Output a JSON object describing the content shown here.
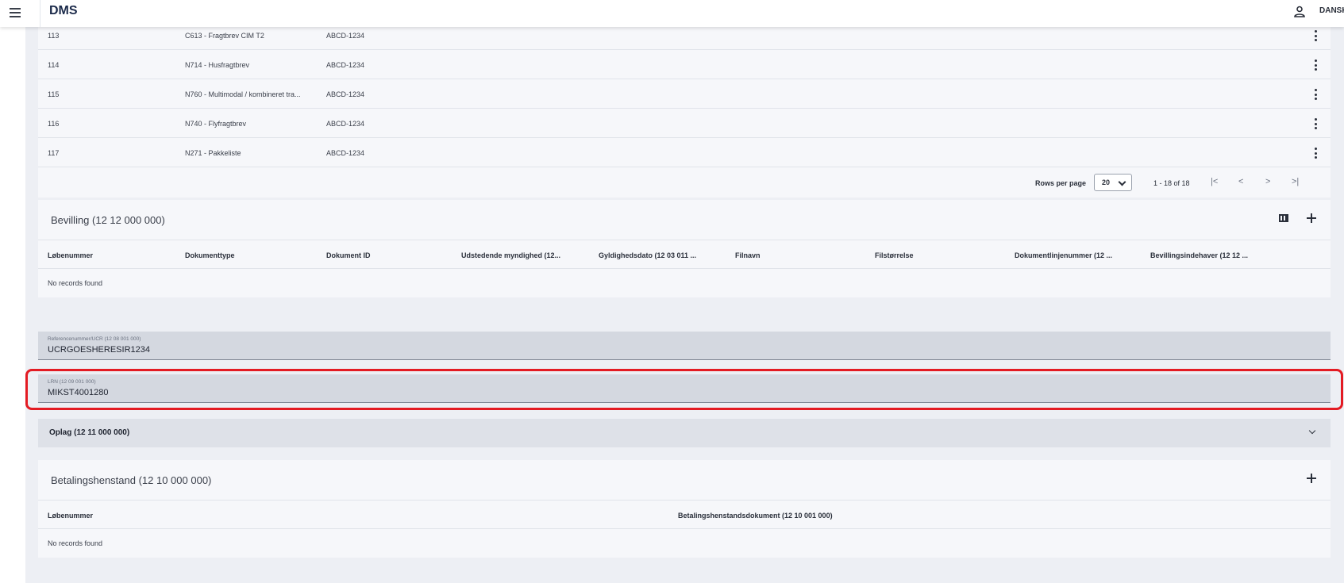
{
  "header": {
    "app_title": "DMS",
    "language": "DANSK",
    "menu_icon": "hamburger-menu-icon",
    "user_icon": "user-icon"
  },
  "documents": {
    "rows": [
      {
        "num": "113",
        "type": "C613 - Fragtbrev CIM T2",
        "id": "ABCD-1234"
      },
      {
        "num": "114",
        "type": "N714 - Husfragtbrev",
        "id": "ABCD-1234"
      },
      {
        "num": "115",
        "type": "N760 - Multimodal / kombineret tra...",
        "id": "ABCD-1234"
      },
      {
        "num": "116",
        "type": "N740 - Flyfragtbrev",
        "id": "ABCD-1234"
      },
      {
        "num": "117",
        "type": "N271 - Pakkeliste",
        "id": "ABCD-1234"
      }
    ],
    "pagination": {
      "rows_per_page_label": "Rows per page",
      "rows_per_page_value": "20",
      "range": "1 - 18 of 18",
      "first": "|<",
      "prev": "<",
      "next": ">",
      "last": ">|"
    }
  },
  "bevilling": {
    "title": "Bevilling (12 12 000 000)",
    "columns": [
      "Løbenummer",
      "Dokumenttype",
      "Dokument ID",
      "Udstedende myndighed (12...",
      "Gyldighedsdato (12 03 011 ...",
      "Filnavn",
      "Filstørrelse",
      "Dokumentlinjenummer (12 ...",
      "Bevillingsindehaver (12 12 ..."
    ],
    "empty": "No records found"
  },
  "fields": {
    "reference": {
      "label": "Referencenummer/UCR (12 08 001 000)",
      "value": "UCRGOESHERESIR1234"
    },
    "lrn": {
      "label": "LRN (12 09 001 000)",
      "value": "MIKST4001280"
    }
  },
  "oplag": {
    "title": "Oplag (12 11 000 000)"
  },
  "betaling": {
    "title": "Betalingshenstand (12 10 000 000)",
    "columns": [
      "Løbenummer",
      "Betalingshenstandsdokument (12 10 001 000)"
    ],
    "empty": "No records found"
  },
  "colors": {
    "highlight": "#e31b23",
    "panel": "#edeff4",
    "card": "#f6f7fa",
    "field": "#d4d8e0"
  }
}
